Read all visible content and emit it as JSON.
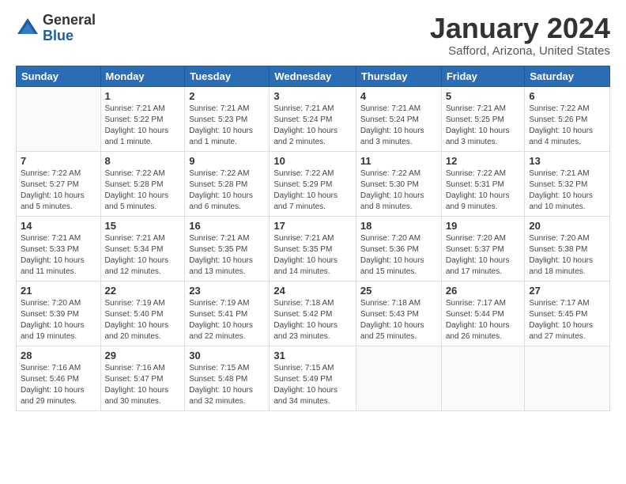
{
  "header": {
    "logo_general": "General",
    "logo_blue": "Blue",
    "month_title": "January 2024",
    "location": "Safford, Arizona, United States"
  },
  "weekdays": [
    "Sunday",
    "Monday",
    "Tuesday",
    "Wednesday",
    "Thursday",
    "Friday",
    "Saturday"
  ],
  "weeks": [
    [
      {
        "day": "",
        "info": ""
      },
      {
        "day": "1",
        "info": "Sunrise: 7:21 AM\nSunset: 5:22 PM\nDaylight: 10 hours\nand 1 minute."
      },
      {
        "day": "2",
        "info": "Sunrise: 7:21 AM\nSunset: 5:23 PM\nDaylight: 10 hours\nand 1 minute."
      },
      {
        "day": "3",
        "info": "Sunrise: 7:21 AM\nSunset: 5:24 PM\nDaylight: 10 hours\nand 2 minutes."
      },
      {
        "day": "4",
        "info": "Sunrise: 7:21 AM\nSunset: 5:24 PM\nDaylight: 10 hours\nand 3 minutes."
      },
      {
        "day": "5",
        "info": "Sunrise: 7:21 AM\nSunset: 5:25 PM\nDaylight: 10 hours\nand 3 minutes."
      },
      {
        "day": "6",
        "info": "Sunrise: 7:22 AM\nSunset: 5:26 PM\nDaylight: 10 hours\nand 4 minutes."
      }
    ],
    [
      {
        "day": "7",
        "info": "Sunrise: 7:22 AM\nSunset: 5:27 PM\nDaylight: 10 hours\nand 5 minutes."
      },
      {
        "day": "8",
        "info": "Sunrise: 7:22 AM\nSunset: 5:28 PM\nDaylight: 10 hours\nand 5 minutes."
      },
      {
        "day": "9",
        "info": "Sunrise: 7:22 AM\nSunset: 5:28 PM\nDaylight: 10 hours\nand 6 minutes."
      },
      {
        "day": "10",
        "info": "Sunrise: 7:22 AM\nSunset: 5:29 PM\nDaylight: 10 hours\nand 7 minutes."
      },
      {
        "day": "11",
        "info": "Sunrise: 7:22 AM\nSunset: 5:30 PM\nDaylight: 10 hours\nand 8 minutes."
      },
      {
        "day": "12",
        "info": "Sunrise: 7:22 AM\nSunset: 5:31 PM\nDaylight: 10 hours\nand 9 minutes."
      },
      {
        "day": "13",
        "info": "Sunrise: 7:21 AM\nSunset: 5:32 PM\nDaylight: 10 hours\nand 10 minutes."
      }
    ],
    [
      {
        "day": "14",
        "info": "Sunrise: 7:21 AM\nSunset: 5:33 PM\nDaylight: 10 hours\nand 11 minutes."
      },
      {
        "day": "15",
        "info": "Sunrise: 7:21 AM\nSunset: 5:34 PM\nDaylight: 10 hours\nand 12 minutes."
      },
      {
        "day": "16",
        "info": "Sunrise: 7:21 AM\nSunset: 5:35 PM\nDaylight: 10 hours\nand 13 minutes."
      },
      {
        "day": "17",
        "info": "Sunrise: 7:21 AM\nSunset: 5:35 PM\nDaylight: 10 hours\nand 14 minutes."
      },
      {
        "day": "18",
        "info": "Sunrise: 7:20 AM\nSunset: 5:36 PM\nDaylight: 10 hours\nand 15 minutes."
      },
      {
        "day": "19",
        "info": "Sunrise: 7:20 AM\nSunset: 5:37 PM\nDaylight: 10 hours\nand 17 minutes."
      },
      {
        "day": "20",
        "info": "Sunrise: 7:20 AM\nSunset: 5:38 PM\nDaylight: 10 hours\nand 18 minutes."
      }
    ],
    [
      {
        "day": "21",
        "info": "Sunrise: 7:20 AM\nSunset: 5:39 PM\nDaylight: 10 hours\nand 19 minutes."
      },
      {
        "day": "22",
        "info": "Sunrise: 7:19 AM\nSunset: 5:40 PM\nDaylight: 10 hours\nand 20 minutes."
      },
      {
        "day": "23",
        "info": "Sunrise: 7:19 AM\nSunset: 5:41 PM\nDaylight: 10 hours\nand 22 minutes."
      },
      {
        "day": "24",
        "info": "Sunrise: 7:18 AM\nSunset: 5:42 PM\nDaylight: 10 hours\nand 23 minutes."
      },
      {
        "day": "25",
        "info": "Sunrise: 7:18 AM\nSunset: 5:43 PM\nDaylight: 10 hours\nand 25 minutes."
      },
      {
        "day": "26",
        "info": "Sunrise: 7:17 AM\nSunset: 5:44 PM\nDaylight: 10 hours\nand 26 minutes."
      },
      {
        "day": "27",
        "info": "Sunrise: 7:17 AM\nSunset: 5:45 PM\nDaylight: 10 hours\nand 27 minutes."
      }
    ],
    [
      {
        "day": "28",
        "info": "Sunrise: 7:16 AM\nSunset: 5:46 PM\nDaylight: 10 hours\nand 29 minutes."
      },
      {
        "day": "29",
        "info": "Sunrise: 7:16 AM\nSunset: 5:47 PM\nDaylight: 10 hours\nand 30 minutes."
      },
      {
        "day": "30",
        "info": "Sunrise: 7:15 AM\nSunset: 5:48 PM\nDaylight: 10 hours\nand 32 minutes."
      },
      {
        "day": "31",
        "info": "Sunrise: 7:15 AM\nSunset: 5:49 PM\nDaylight: 10 hours\nand 34 minutes."
      },
      {
        "day": "",
        "info": ""
      },
      {
        "day": "",
        "info": ""
      },
      {
        "day": "",
        "info": ""
      }
    ]
  ]
}
